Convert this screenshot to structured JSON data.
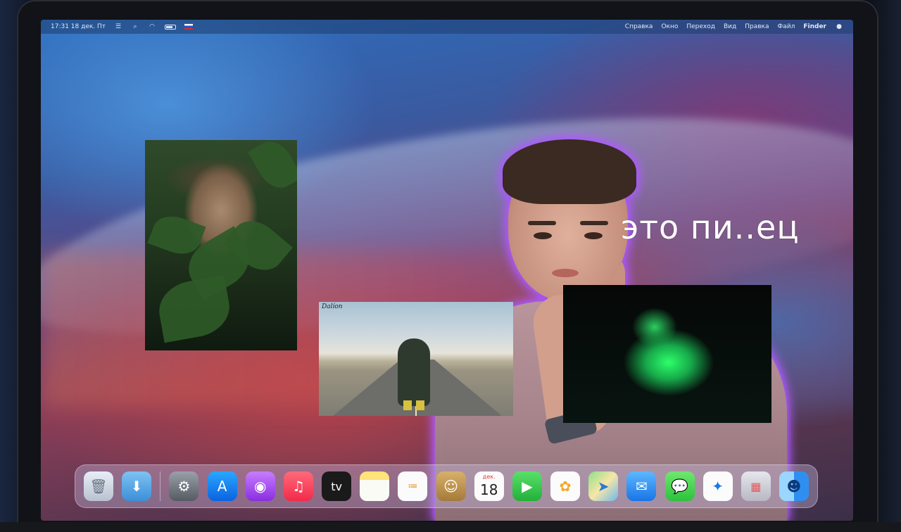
{
  "menubar": {
    "left": {
      "datetime": "17:31 18 дек. Пт"
    },
    "menus": [
      "Справка",
      "Окно",
      "Переход",
      "Вид",
      "Правка",
      "Файл",
      "Finder"
    ]
  },
  "caption": "это пи..ец",
  "road_photo_sign": "Dalíon",
  "dock": {
    "items": [
      {
        "name": "trash",
        "icon": "trash-icon"
      },
      {
        "name": "downloads",
        "icon": "downloads-folder-icon"
      },
      {
        "name": "system-preferences",
        "icon": "settings-gear-icon"
      },
      {
        "name": "app-store",
        "icon": "app-store-icon"
      },
      {
        "name": "podcasts",
        "icon": "podcasts-icon"
      },
      {
        "name": "music",
        "icon": "music-note-icon"
      },
      {
        "name": "apple-tv",
        "icon": "tv-icon"
      },
      {
        "name": "notes",
        "icon": "notes-icon"
      },
      {
        "name": "reminders",
        "icon": "reminders-icon"
      },
      {
        "name": "contacts",
        "icon": "contacts-icon"
      },
      {
        "name": "calendar",
        "icon": "calendar-icon"
      },
      {
        "name": "facetime",
        "icon": "facetime-camera-icon"
      },
      {
        "name": "photos",
        "icon": "photos-flower-icon"
      },
      {
        "name": "maps",
        "icon": "maps-icon"
      },
      {
        "name": "mail",
        "icon": "mail-envelope-icon"
      },
      {
        "name": "messages",
        "icon": "messages-bubble-icon"
      },
      {
        "name": "safari",
        "icon": "safari-compass-icon"
      },
      {
        "name": "launchpad",
        "icon": "launchpad-grid-icon"
      },
      {
        "name": "finder",
        "icon": "finder-face-icon"
      }
    ],
    "calendar_month": "дек.",
    "calendar_day": "18",
    "tv_label": "tv"
  }
}
